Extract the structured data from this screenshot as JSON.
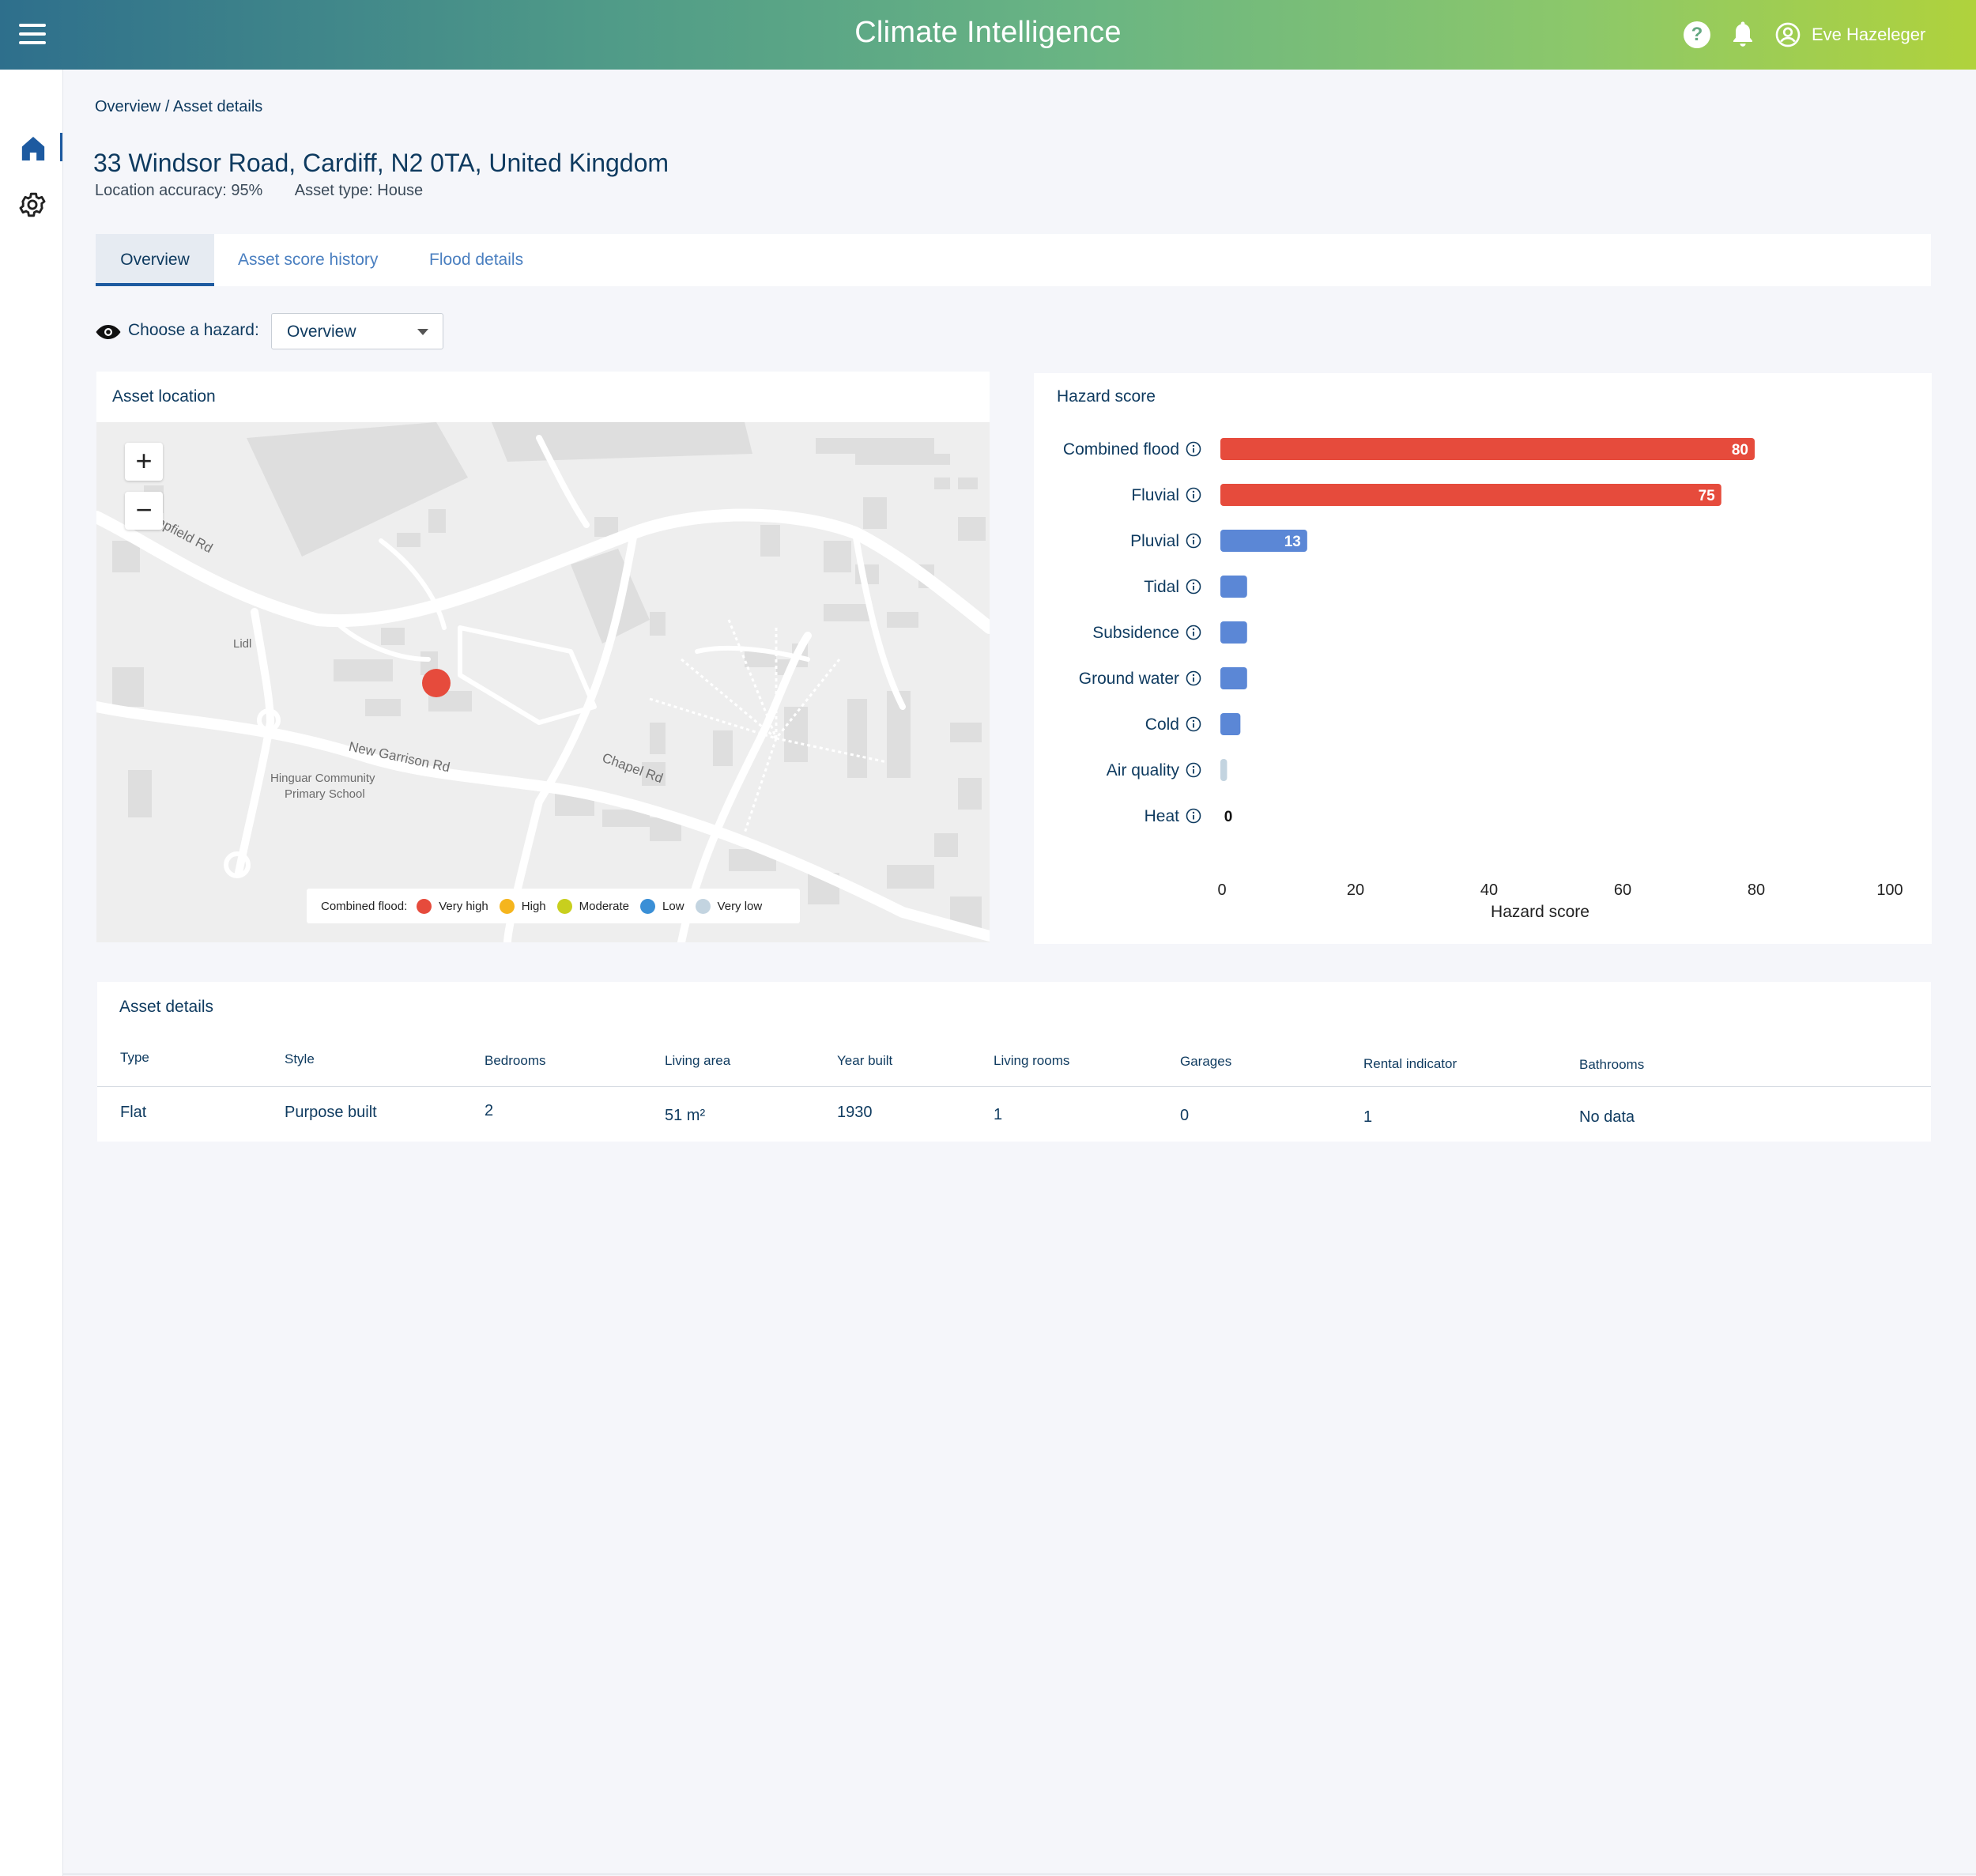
{
  "header": {
    "title": "Climate Intelligence",
    "user_name": "Eve Hazeleger",
    "gradient": [
      "#2e6f8c",
      "#b0d23c"
    ]
  },
  "breadcrumb": "Overview / Asset details",
  "asset": {
    "address": "33 Windsor Road, Cardiff, N2 0TA, United Kingdom",
    "location_accuracy": "Location accuracy: 95%",
    "asset_type": "Asset type: House"
  },
  "tabs": [
    {
      "label": "Overview",
      "active": true
    },
    {
      "label": "Asset score history",
      "active": false
    },
    {
      "label": "Flood details",
      "active": false
    }
  ],
  "hazard_chooser": {
    "label": "Choose a hazard:",
    "selected": "Overview"
  },
  "map": {
    "title": "Asset location",
    "zoom_in": "+",
    "zoom_out": "−",
    "labels": {
      "road1": "ampfield Rd",
      "lidl": "Lidl",
      "road2": "New Garrison Rd",
      "road3": "Chapel Rd",
      "school_line1": "Hinguar Community",
      "school_line2": "Primary School"
    },
    "marker_color": "#e64b3c",
    "legend": {
      "title": "Combined flood:",
      "items": [
        {
          "label": "Very high",
          "color": "#e64b3c"
        },
        {
          "label": "High",
          "color": "#f5b51d"
        },
        {
          "label": "Moderate",
          "color": "#c8cf1e"
        },
        {
          "label": "Low",
          "color": "#3a8fd6"
        },
        {
          "label": "Very low",
          "color": "#c3d4e0"
        }
      ]
    }
  },
  "chart_title": "Hazard score",
  "chart_data": {
    "type": "bar",
    "orientation": "horizontal",
    "categories": [
      "Combined flood",
      "Fluvial",
      "Pluvial",
      "Tidal",
      "Subsidence",
      "Ground water",
      "Cold",
      "Air quality",
      "Heat"
    ],
    "values": [
      80,
      75,
      13,
      4,
      4,
      4,
      3,
      1,
      0
    ],
    "value_labels": [
      "80",
      "75",
      "13",
      "",
      "",
      "",
      "",
      "",
      "0"
    ],
    "colors": [
      "#e64b3c",
      "#e64b3c",
      "#5b87d6",
      "#5b87d6",
      "#5b87d6",
      "#5b87d6",
      "#5b87d6",
      "#c3d4e0",
      "#5b87d6"
    ],
    "xlabel": "Hazard score",
    "xlim": [
      0,
      100
    ],
    "xticks": [
      0,
      20,
      40,
      60,
      80,
      100
    ]
  },
  "details": {
    "title": "Asset details",
    "columns": [
      "Type",
      "Style",
      "Bedrooms",
      "Living area",
      "Year built",
      "Living rooms",
      "Garages",
      "Rental indicator",
      "Bathrooms"
    ],
    "row": [
      "Flat",
      "Purpose built",
      "2",
      "51 m²",
      "1930",
      "1",
      "0",
      "1",
      "No data"
    ]
  }
}
